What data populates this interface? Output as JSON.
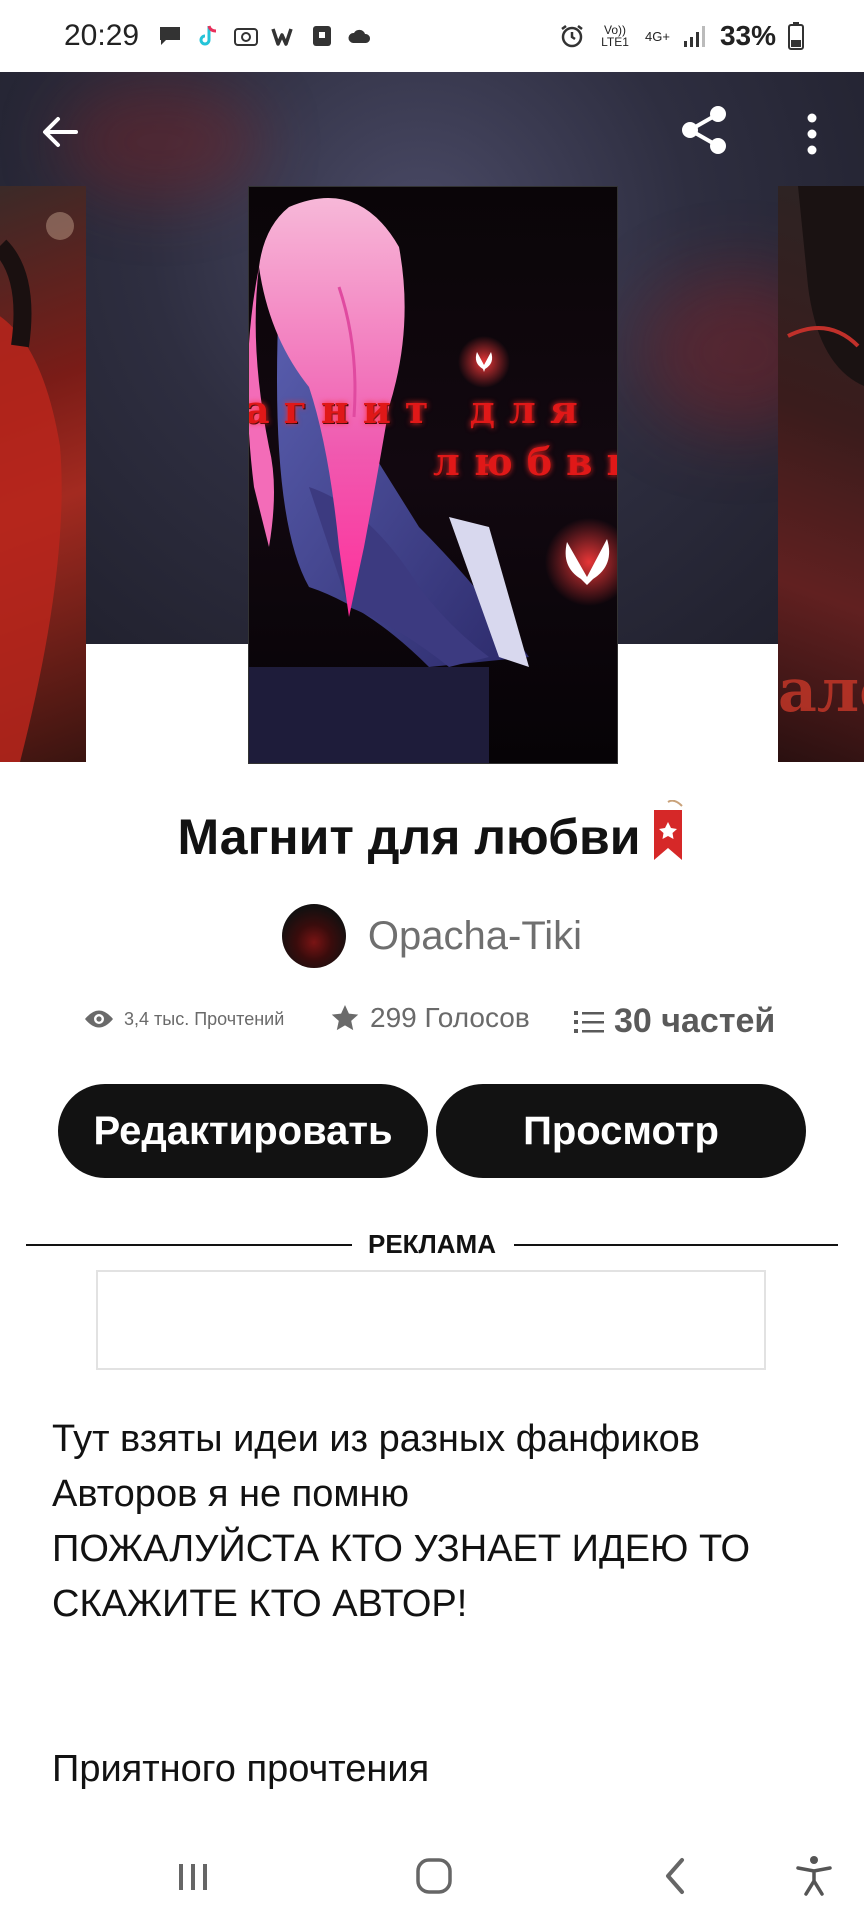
{
  "status_bar": {
    "time": "20:29",
    "network_label": "Vo)) LTE1",
    "network_type": "4G+",
    "battery": "33%"
  },
  "nav": {
    "back_icon": "arrow-left-icon",
    "share_icon": "share-icon",
    "more_icon": "more-vertical-icon"
  },
  "cover": {
    "title_line1": "агнит для",
    "title_line2": "любви",
    "side_text_right": "ало"
  },
  "story": {
    "title": "Магнит для любви",
    "author": "Opacha-Tiki"
  },
  "stats": {
    "reads": "3,4 тыс. Прочтений",
    "votes": "299 Голосов",
    "parts": "30 частей"
  },
  "buttons": {
    "edit": "Редактировать",
    "view": "Просмотр"
  },
  "ad": {
    "label": "РЕКЛАМА"
  },
  "description": {
    "line1": "Тут взяты идеи из разных фанфиков",
    "line2": "Авторов я не помню",
    "line3": "ПОЖАЛУЙСТА КТО УЗНАЕТ ИДЕЮ ТО",
    "line4": "СКАЖИТЕ КТО АВТОР!",
    "line5": "Приятного прочтения"
  },
  "colors": {
    "button_bg": "#121212",
    "text_primary": "#121212",
    "text_muted": "#6f6f6f",
    "accent_red": "#e01818"
  }
}
